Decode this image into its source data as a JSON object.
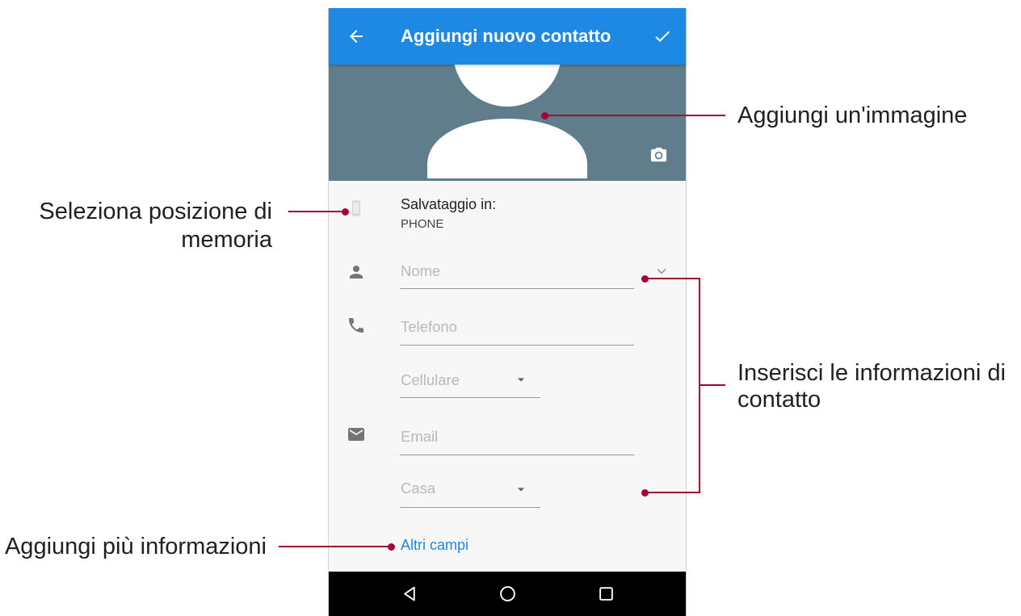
{
  "theme": {
    "primary": "#1E88E5",
    "photo_background": "#607D8B",
    "link": "#1E88E5",
    "annotation": "#A50034"
  },
  "app_bar": {
    "back_icon": "arrow-back-icon",
    "title": "Aggiungi nuovo contatto",
    "save_icon": "check-icon"
  },
  "photo": {
    "placeholder_icon": "person-silhouette-icon",
    "camera_icon": "camera-icon"
  },
  "storage": {
    "icon": "smartphone-icon",
    "label": "Salvataggio in:",
    "value": "PHONE"
  },
  "form": {
    "name": {
      "icon": "person-icon",
      "placeholder": "Nome",
      "expand_icon": "chevron-down-icon"
    },
    "phone": {
      "icon": "phone-icon",
      "placeholder": "Telefono",
      "type": "Cellulare",
      "type_icon": "dropdown-arrow-icon"
    },
    "email": {
      "icon": "email-icon",
      "placeholder": "Email",
      "type": "Casa",
      "type_icon": "dropdown-arrow-icon"
    },
    "more_fields": "Altri campi"
  },
  "nav_bar": {
    "back_icon": "nav-back-icon",
    "home_icon": "nav-home-icon",
    "recents_icon": "nav-recents-icon"
  },
  "annotations": {
    "add_image": "Aggiungi un'immagine",
    "storage_location": [
      "Seleziona posizione di",
      "memoria"
    ],
    "contact_info": [
      "Inserisci le informazioni di",
      "contatto"
    ],
    "more_info": "Aggiungi più informazioni"
  }
}
